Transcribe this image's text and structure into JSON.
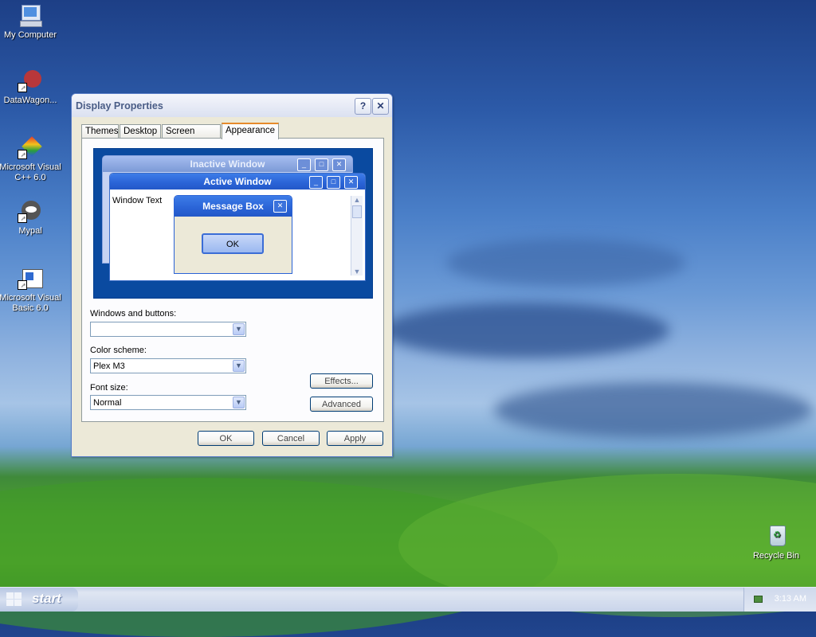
{
  "desktop": {
    "icons": [
      {
        "label": "My Computer",
        "icon": "my-computer-icon"
      },
      {
        "label": "DataWagon...",
        "icon": "datawagon-icon"
      },
      {
        "label_line1": "Microsoft Visual",
        "label_line2": "C++ 6.0",
        "icon": "visual-cpp-icon"
      },
      {
        "label": "Mypal",
        "icon": "mypal-icon"
      },
      {
        "label_line1": "Microsoft Visual",
        "label_line2": "Basic 6.0",
        "icon": "visual-basic-icon"
      },
      {
        "label": "Recycle Bin",
        "icon": "recycle-bin-icon"
      }
    ]
  },
  "dialog": {
    "title": "Display Properties",
    "help_label": "?",
    "close_label": "✕",
    "tabs": [
      {
        "label": "Themes"
      },
      {
        "label": "Desktop"
      },
      {
        "label": "Screen Saver"
      },
      {
        "label": "Appearance",
        "active": true
      }
    ],
    "preview": {
      "inactive_title": "Inactive Window",
      "active_title": "Active Window",
      "window_text": "Window Text",
      "message_box_title": "Message Box",
      "ok_label": "OK",
      "min_glyph": "_",
      "max_glyph": "□",
      "close_glyph": "✕"
    },
    "windows_buttons": {
      "label": "Windows and buttons:",
      "value": ""
    },
    "color_scheme": {
      "label": "Color scheme:",
      "value": "Plex M3"
    },
    "font_size": {
      "label": "Font size:",
      "value": "Normal"
    },
    "effects_label": "Effects...",
    "advanced_label": "Advanced",
    "ok_label": "OK",
    "cancel_label": "Cancel",
    "apply_label": "Apply",
    "dropdown_glyph": "▼"
  },
  "taskbar": {
    "start_label": "start",
    "clock": "3:13 AM"
  },
  "colors": {
    "active_title": "#2a63d6",
    "inactive_title": "#7c9ad6",
    "preview_bg": "#0a4aa0"
  }
}
